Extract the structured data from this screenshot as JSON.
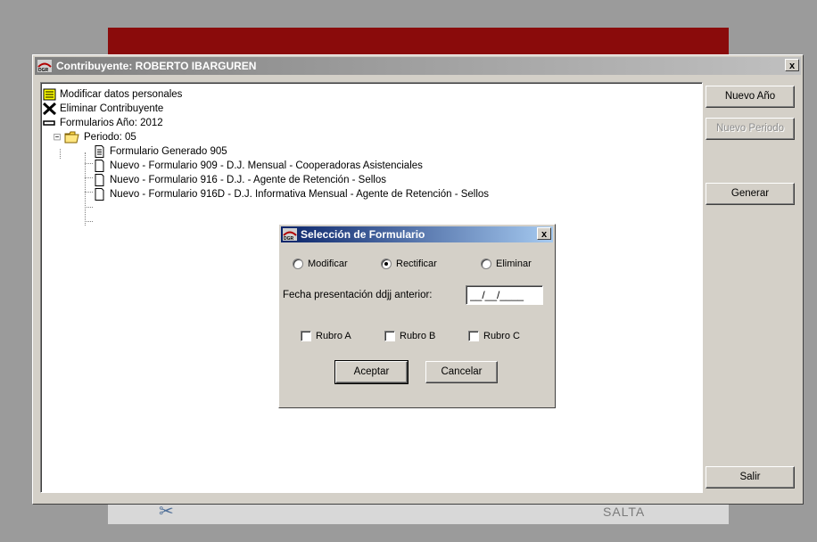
{
  "background": {
    "footer_text": "SALTA"
  },
  "main_window": {
    "title": "Contribuyente: ROBERTO IBARGUREN",
    "close_label": "x"
  },
  "tree": {
    "items": [
      {
        "label": "Modificar datos personales",
        "icon": "notes-icon"
      },
      {
        "label": "Eliminar Contribuyente",
        "icon": "x-delete-icon"
      },
      {
        "label": "Formularios Año: 2012",
        "icon": "minus-icon"
      },
      {
        "label": "Periodo: 05",
        "icon": "folder-open-icon"
      },
      {
        "label": "Formulario Generado 905",
        "icon": "document-lines-icon"
      },
      {
        "label": "Nuevo - Formulario 909 - D.J. Mensual - Cooperadoras Asistenciales",
        "icon": "document-blank-icon"
      },
      {
        "label": "Nuevo - Formulario 916 - D.J. - Agente de Retención - Sellos",
        "icon": "document-blank-icon"
      },
      {
        "label": "Nuevo - Formulario 916D - D.J. Informativa Mensual - Agente de Retención - Sellos",
        "icon": "document-blank-icon"
      }
    ]
  },
  "buttons": {
    "nuevo_anio": "Nuevo Año",
    "nuevo_periodo": "Nuevo Periodo",
    "generar": "Generar",
    "salir": "Salir"
  },
  "dialog": {
    "title": "Selección de Formulario",
    "close_label": "x",
    "radios": [
      {
        "label": "Modificar",
        "checked": false
      },
      {
        "label": "Rectificar",
        "checked": true
      },
      {
        "label": "Eliminar",
        "checked": false
      }
    ],
    "date_label": "Fecha presentación ddjj anterior:",
    "date_value": "__/__/____",
    "checkboxes": [
      {
        "label": "Rubro A",
        "checked": false
      },
      {
        "label": "Rubro B",
        "checked": false
      },
      {
        "label": "Rubro C",
        "checked": false
      }
    ],
    "accept_label": "Aceptar",
    "cancel_label": "Cancelar"
  }
}
